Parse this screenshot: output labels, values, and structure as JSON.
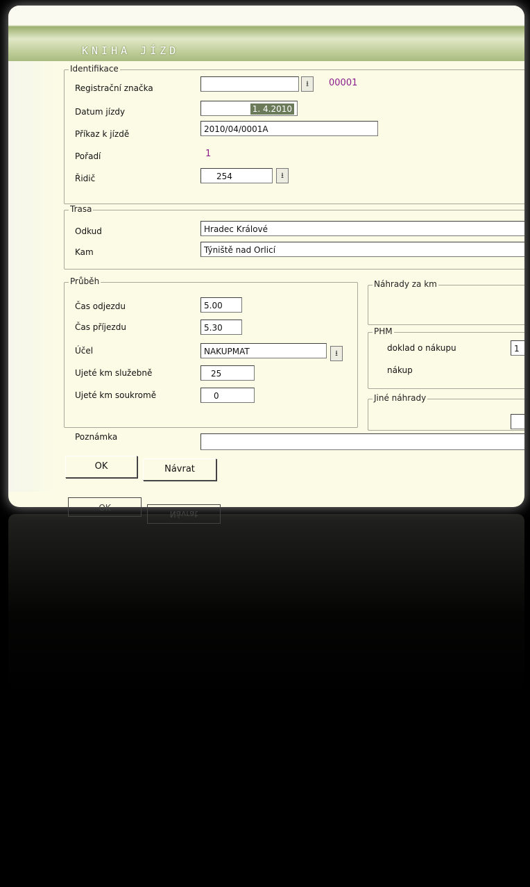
{
  "window": {
    "title": "KNIHA JÍZD"
  },
  "identifikace": {
    "label": "Identifikace",
    "reg_label": "Registrační značka",
    "reg_value": "",
    "reg_code": "00001",
    "datum_label": "Datum jízdy",
    "datum_value": "1. 4.2010",
    "prikaz_label": "Příkaz k jízdě",
    "prikaz_value": "2010/04/0001A",
    "poradi_label": "Pořadí",
    "poradi_value": "1",
    "ridic_label": "Řidič",
    "ridic_value": "254"
  },
  "trasa": {
    "label": "Trasa",
    "odkud_label": "Odkud",
    "odkud_value": "Hradec Králové",
    "kam_label": "Kam",
    "kam_value": "Týniště nad Orlicí"
  },
  "prubeh": {
    "label": "Průběh",
    "odjezd_label": "Čas odjezdu",
    "odjezd_value": "5.00",
    "prijezd_label": "Čas příjezdu",
    "prijezd_value": "5.30",
    "ucel_label": "Účel",
    "ucel_value": "NAKUPMAT",
    "sluzebne_label": "Ujeté km služebně",
    "sluzebne_value": "25",
    "soukrome_label": "Ujeté km soukromě",
    "soukrome_value": "0"
  },
  "nahrady_km": {
    "label": "Náhrady za km"
  },
  "phm": {
    "label": "PHM",
    "doklad_label": "doklad o nákupu",
    "doklad_value": "1",
    "nakup_label": "nákup"
  },
  "jine_nahrady": {
    "label": "Jiné náhrady"
  },
  "poznamka": {
    "label": "Poznámka",
    "value": ""
  },
  "buttons": {
    "ok": "OK",
    "navrat": "Návrat"
  },
  "icons": {
    "dropdown": "⭳"
  }
}
